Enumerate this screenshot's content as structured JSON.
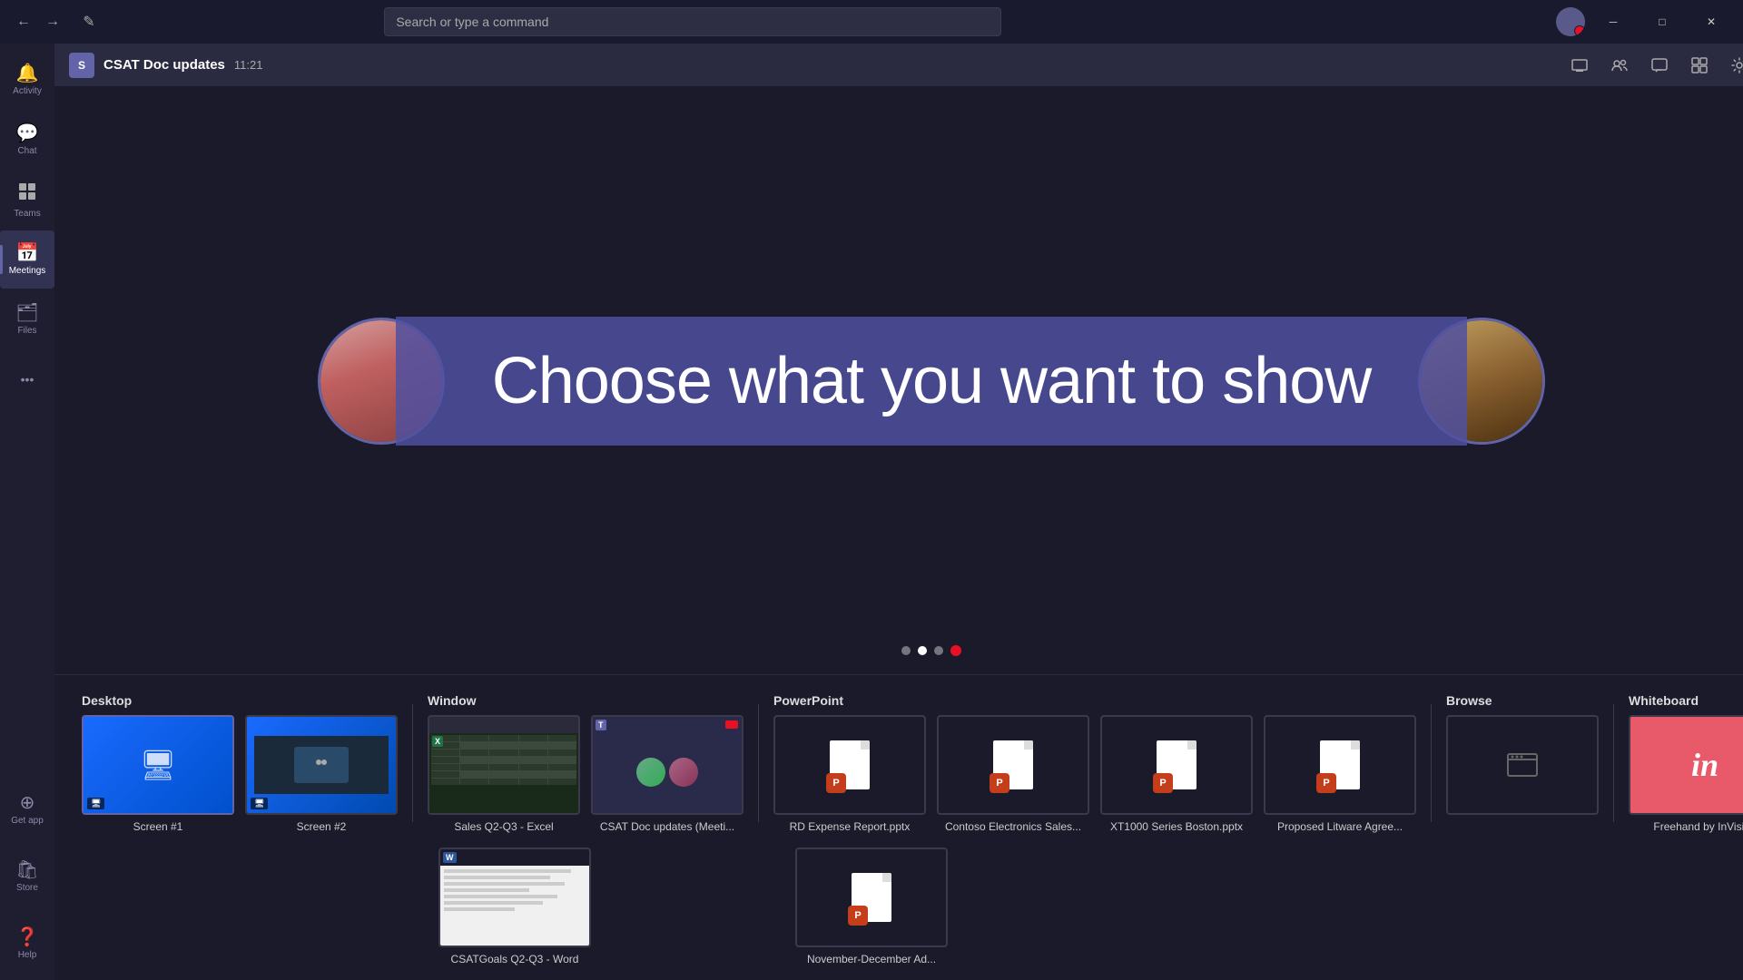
{
  "titlebar": {
    "search_placeholder": "Search or type a command",
    "back_label": "←",
    "forward_label": "→",
    "compose_label": "✎",
    "minimize_label": "─",
    "maximize_label": "□",
    "close_label": "✕"
  },
  "sidebar": {
    "items": [
      {
        "id": "activity",
        "label": "Activity",
        "icon": "🔔"
      },
      {
        "id": "chat",
        "label": "Chat",
        "icon": "💬"
      },
      {
        "id": "teams",
        "label": "Teams",
        "icon": "⊞"
      },
      {
        "id": "meetings",
        "label": "Meetings",
        "icon": "📅"
      },
      {
        "id": "files",
        "label": "Files",
        "icon": "🗂"
      }
    ],
    "bottom_items": [
      {
        "id": "getapp",
        "label": "Get app",
        "icon": "⊕"
      },
      {
        "id": "store",
        "label": "Store",
        "icon": "🛍"
      },
      {
        "id": "help",
        "label": "Help",
        "icon": "❓"
      }
    ],
    "more_label": "•••"
  },
  "meeting_header": {
    "icon_label": "S",
    "title": "CSAT Doc updates",
    "time": "11:21",
    "actions": [
      {
        "id": "share-screen",
        "label": "⊡"
      },
      {
        "id": "participants",
        "label": "⊞"
      },
      {
        "id": "chat-panel",
        "label": "💬"
      },
      {
        "id": "apps",
        "label": "⚙"
      },
      {
        "id": "settings",
        "label": "⚙"
      },
      {
        "id": "info",
        "label": "ℹ"
      }
    ]
  },
  "share_overlay": {
    "text": "Choose what you want to show"
  },
  "share_panel": {
    "sections": [
      {
        "id": "desktop",
        "label": "Desktop",
        "items": [
          {
            "id": "screen1",
            "label": "Screen #1",
            "type": "desktop"
          },
          {
            "id": "screen2",
            "label": "Screen #2",
            "type": "desktop2"
          }
        ]
      },
      {
        "id": "window",
        "label": "Window",
        "items": [
          {
            "id": "excel-win",
            "label": "Sales Q2-Q3 - Excel",
            "type": "excel"
          },
          {
            "id": "teams-win",
            "label": "CSAT Doc updates (Meeti...",
            "type": "teams"
          }
        ]
      },
      {
        "id": "powerpoint",
        "label": "PowerPoint",
        "items": [
          {
            "id": "pptx1",
            "label": "RD Expense Report.pptx",
            "type": "pptx"
          },
          {
            "id": "pptx2",
            "label": "Contoso Electronics Sales...",
            "type": "pptx"
          },
          {
            "id": "pptx3",
            "label": "XT1000 Series Boston.pptx",
            "type": "pptx"
          },
          {
            "id": "pptx4",
            "label": "Proposed Litware Agree...",
            "type": "pptx"
          },
          {
            "id": "pptx5",
            "label": "November-December Ad...",
            "type": "pptx"
          }
        ]
      },
      {
        "id": "browse",
        "label": "Browse",
        "items": []
      },
      {
        "id": "whiteboard",
        "label": "Whiteboard",
        "items": [
          {
            "id": "wb1",
            "label": "Freehand by InVision",
            "type": "whiteboard"
          }
        ]
      }
    ]
  }
}
